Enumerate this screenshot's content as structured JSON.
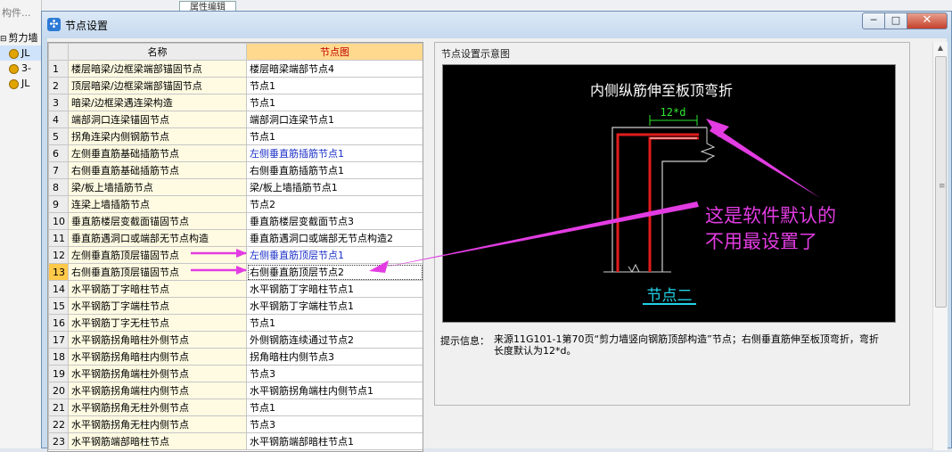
{
  "background": {
    "search_text": "构件...",
    "tab_label": "属性编辑",
    "tree": [
      "剪力墙",
      "JL",
      "3-",
      "JL"
    ]
  },
  "window": {
    "title": "节点设置",
    "minimize_glyph": "─",
    "maximize_glyph": "□",
    "close_glyph": "✕"
  },
  "table": {
    "headers": {
      "num": "",
      "name": "名称",
      "image": "节点图"
    },
    "selected_row": 13,
    "rows": [
      {
        "num": "1",
        "name": "楼层暗梁/边框梁端部锚固节点",
        "image": "楼层暗梁端部节点4"
      },
      {
        "num": "2",
        "name": "顶层暗梁/边框梁端部锚固节点",
        "image": "节点1"
      },
      {
        "num": "3",
        "name": "暗梁/边框梁遇连梁构造",
        "image": "节点1"
      },
      {
        "num": "4",
        "name": "端部洞口连梁锚固节点",
        "image": "端部洞口连梁节点1"
      },
      {
        "num": "5",
        "name": "拐角连梁内侧钢筋节点",
        "image": "节点1"
      },
      {
        "num": "6",
        "name": "左侧垂直筋基础插筋节点",
        "image": "左侧垂直筋插筋节点1"
      },
      {
        "num": "7",
        "name": "右侧垂直筋基础插筋节点",
        "image": "右侧垂直筋插筋节点1"
      },
      {
        "num": "8",
        "name": "梁/板上墙插筋节点",
        "image": "梁/板上墙插筋节点1"
      },
      {
        "num": "9",
        "name": "连梁上墙插筋节点",
        "image": "节点2"
      },
      {
        "num": "10",
        "name": "垂直筋楼层变截面锚固节点",
        "image": "垂直筋楼层变截面节点3"
      },
      {
        "num": "11",
        "name": "垂直筋遇洞口或端部无节点构造",
        "image": "垂直筋遇洞口或端部无节点构造2"
      },
      {
        "num": "12",
        "name": "左侧垂直筋顶层锚固节点",
        "image": "左侧垂直筋顶层节点1"
      },
      {
        "num": "13",
        "name": "右侧垂直筋顶层锚固节点",
        "image": "右侧垂直筋顶层节点2"
      },
      {
        "num": "14",
        "name": "水平钢筋丁字暗柱节点",
        "image": "水平钢筋丁字暗柱节点1"
      },
      {
        "num": "15",
        "name": "水平钢筋丁字端柱节点",
        "image": "水平钢筋丁字端柱节点1"
      },
      {
        "num": "16",
        "name": "水平钢筋丁字无柱节点",
        "image": "节点1"
      },
      {
        "num": "17",
        "name": "水平钢筋拐角暗柱外侧节点",
        "image": "外侧钢筋连续通过节点2"
      },
      {
        "num": "18",
        "name": "水平钢筋拐角暗柱内侧节点",
        "image": "拐角暗柱内侧节点3"
      },
      {
        "num": "19",
        "name": "水平钢筋拐角端柱外侧节点",
        "image": "节点3"
      },
      {
        "num": "20",
        "name": "水平钢筋拐角端柱内侧节点",
        "image": "水平钢筋拐角端柱内侧节点1"
      },
      {
        "num": "21",
        "name": "水平钢筋拐角无柱外侧节点",
        "image": "节点1"
      },
      {
        "num": "22",
        "name": "水平钢筋拐角无柱内侧节点",
        "image": "节点3"
      },
      {
        "num": "23",
        "name": "水平钢筋端部暗柱节点",
        "image": "水平钢筋端部暗柱节点1"
      }
    ]
  },
  "diagram": {
    "group_title": "节点设置示意图",
    "heading": "内侧纵筋伸至板顶弯折",
    "dimension": "12*d",
    "node_label": "节点二"
  },
  "hint": {
    "label": "提示信息：",
    "text": "来源11G101-1第70页“剪力墙竖向钢筋顶部构造”节点；右侧垂直筋伸至板顶弯折，弯折长度默认为12*d。"
  },
  "annotation": {
    "line1": "这是软件默认的",
    "line2": "不用最设置了",
    "color": "#e23ce2"
  }
}
